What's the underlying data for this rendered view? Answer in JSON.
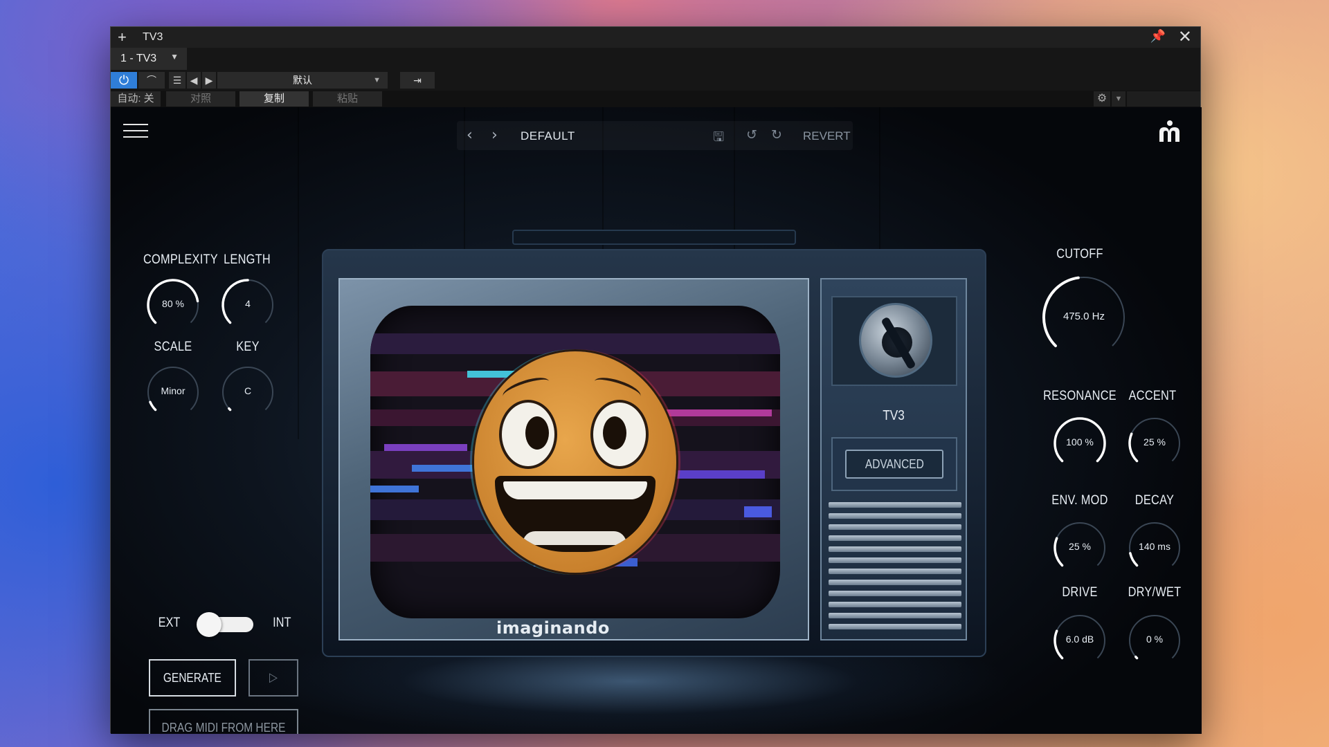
{
  "host": {
    "window_title": "TV3",
    "instance": "1 - TV3",
    "preset": "默认",
    "auto_label": "自动: 关",
    "compare_label": "对照",
    "copy_label": "复制",
    "paste_label": "粘贴"
  },
  "plugin": {
    "preset_name": "DEFAULT",
    "revert_label": "REVERT",
    "tv_name": "TV3",
    "advanced_label": "ADVANCED",
    "brand": "imaginando",
    "ext_label": "EXT",
    "int_label": "INT",
    "source_toggle": "INT",
    "generate_label": "GENERATE",
    "drag_label": "DRAG MIDI FROM HERE"
  },
  "knobs": {
    "complexity": {
      "label": "COMPLEXITY",
      "value": "80 %",
      "level": 0.8
    },
    "length": {
      "label": "LENGTH",
      "value": "4",
      "level": 0.5
    },
    "scale": {
      "label": "SCALE",
      "value": "Minor",
      "level": 0.08
    },
    "key": {
      "label": "KEY",
      "value": "C",
      "level": 0.0
    },
    "cutoff": {
      "label": "CUTOFF",
      "value": "475.0 Hz",
      "level": 0.47
    },
    "resonance": {
      "label": "RESONANCE",
      "value": "100 %",
      "level": 1.0
    },
    "accent": {
      "label": "ACCENT",
      "value": "25 %",
      "level": 0.25
    },
    "env_mod": {
      "label": "ENV. MOD",
      "value": "25 %",
      "level": 0.25
    },
    "decay": {
      "label": "DECAY",
      "value": "140 ms",
      "level": 0.12
    },
    "drive": {
      "label": "DRIVE",
      "value": "6.0 dB",
      "level": 0.25
    },
    "dry_wet": {
      "label": "DRY/WET",
      "value": "0 %",
      "level": 0.0
    }
  },
  "icons": {
    "power": "power-icon",
    "settings": "gear-icon",
    "menu": "hamburger-menu-icon",
    "save": "save-icon",
    "undo": "undo-icon",
    "redo": "redo-icon",
    "play": "play-icon"
  },
  "colors": {
    "power_active": "#2f7ed8",
    "knob_arc": "#ffffff",
    "knob_track": "#3a4654"
  }
}
